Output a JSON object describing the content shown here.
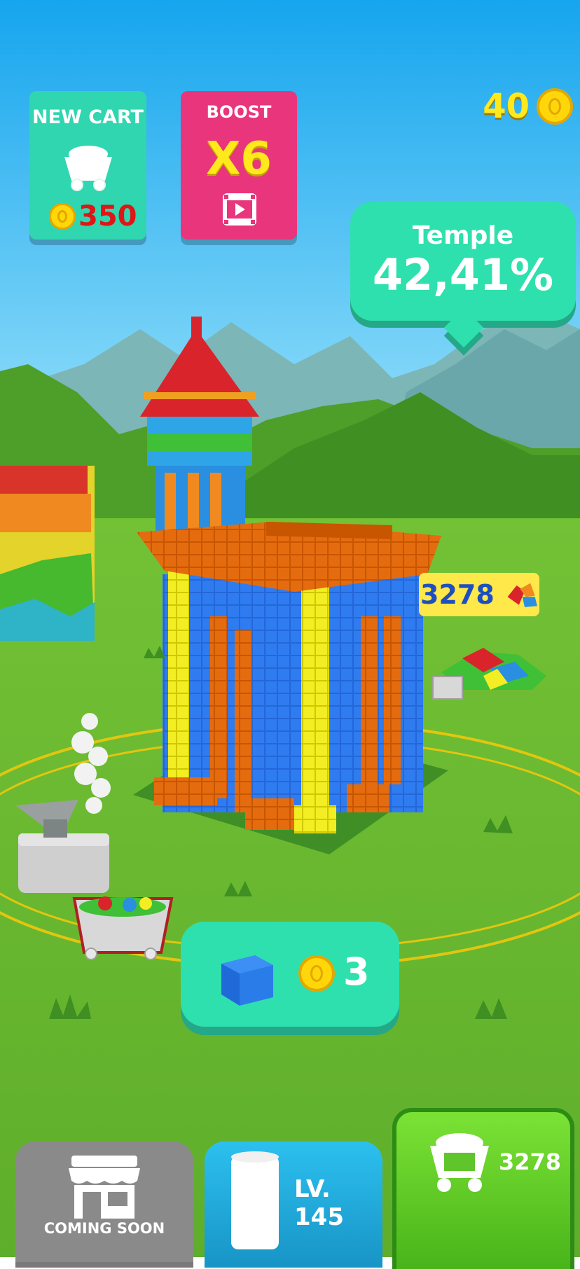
{
  "hud": {
    "coins": "40",
    "new_cart": {
      "title": "NEW CART",
      "price": "350"
    },
    "boost": {
      "title": "BOOST",
      "multiplier": "X6"
    }
  },
  "building": {
    "name": "Temple",
    "progress": "42,41%"
  },
  "resource_label": {
    "amount": "3278"
  },
  "buy_block": {
    "price": "3"
  },
  "bottom_bar": {
    "shop_label": "COMING SOON",
    "level_label": "LV. 145",
    "cart_amount": "3278"
  }
}
